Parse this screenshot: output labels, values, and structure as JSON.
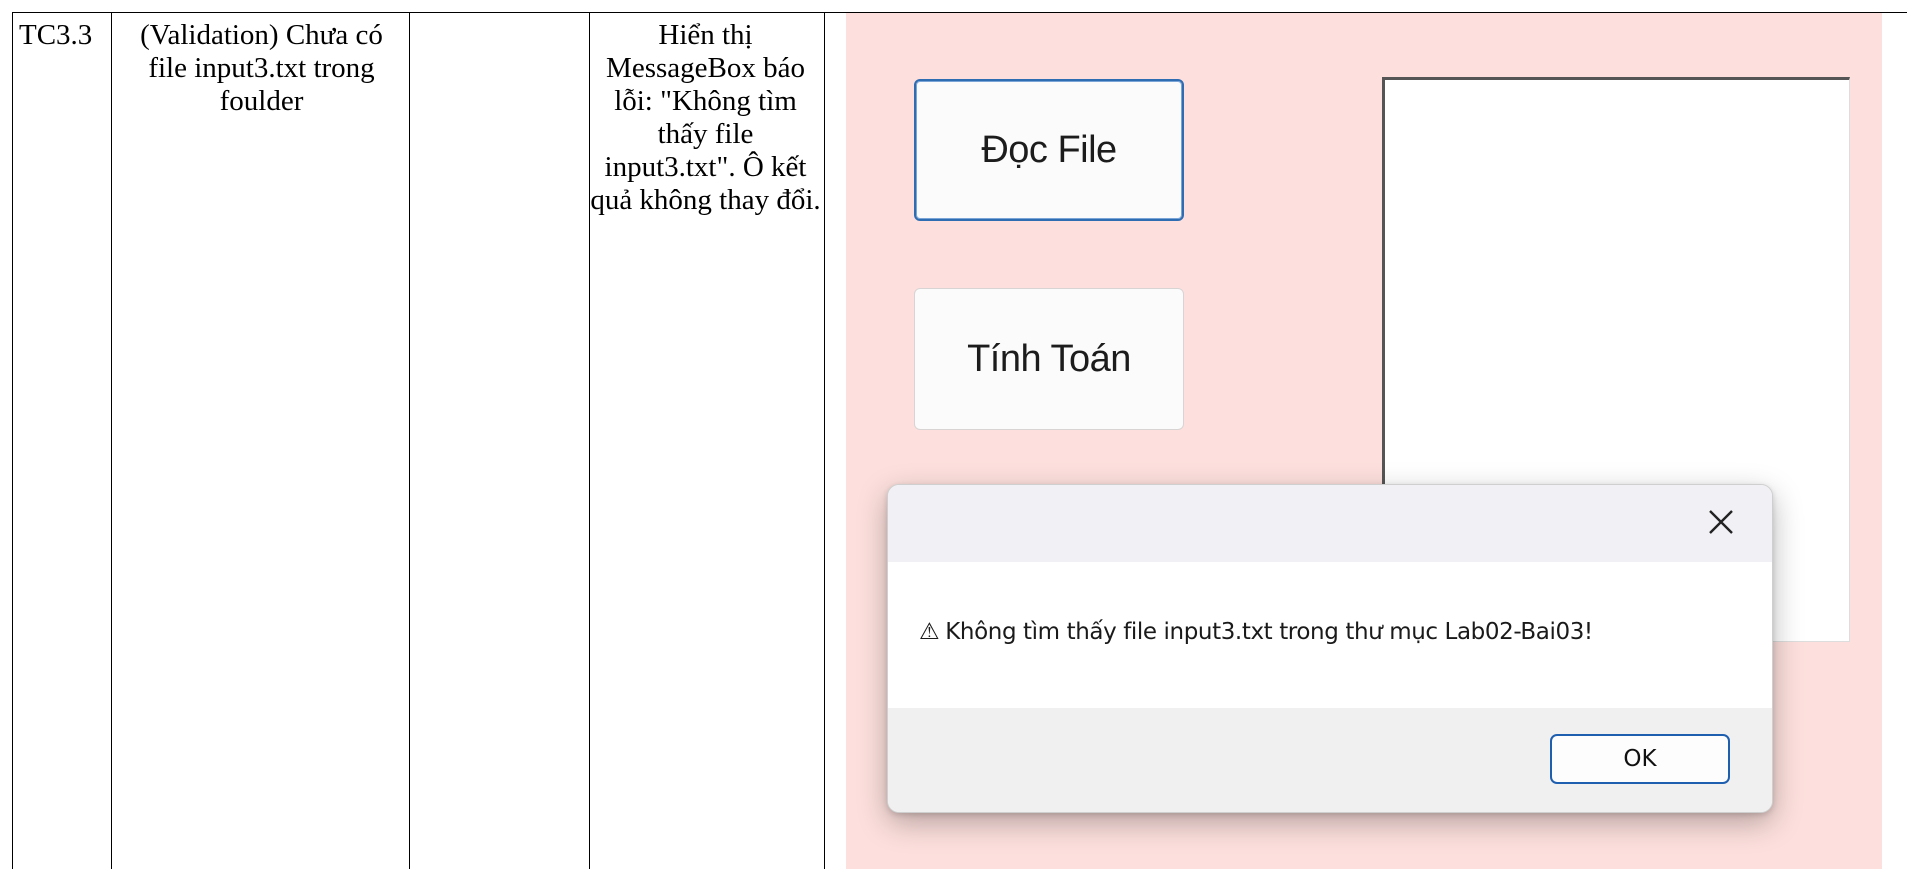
{
  "table": {
    "col_id": "TC3.3",
    "col_description": "(Validation) Chưa có file input3.txt trong foulder",
    "col_input": "",
    "col_expected": "Hiển thị MessageBox báo lỗi: \"Không tìm thấy file input3.txt\". Ô kết quả không thay đổi."
  },
  "app": {
    "read_button_label": "Đọc File",
    "calc_button_label": "Tính Toán",
    "result_text": ""
  },
  "dialog": {
    "warning_icon": "⚠",
    "message": "Không tìm thấy file input3.txt trong thư mục Lab02-Bai03!",
    "ok_label": "OK",
    "close_icon": "close-icon"
  },
  "colors": {
    "panel_background": "#fde0dd",
    "accent_blue": "#2f6db3"
  }
}
